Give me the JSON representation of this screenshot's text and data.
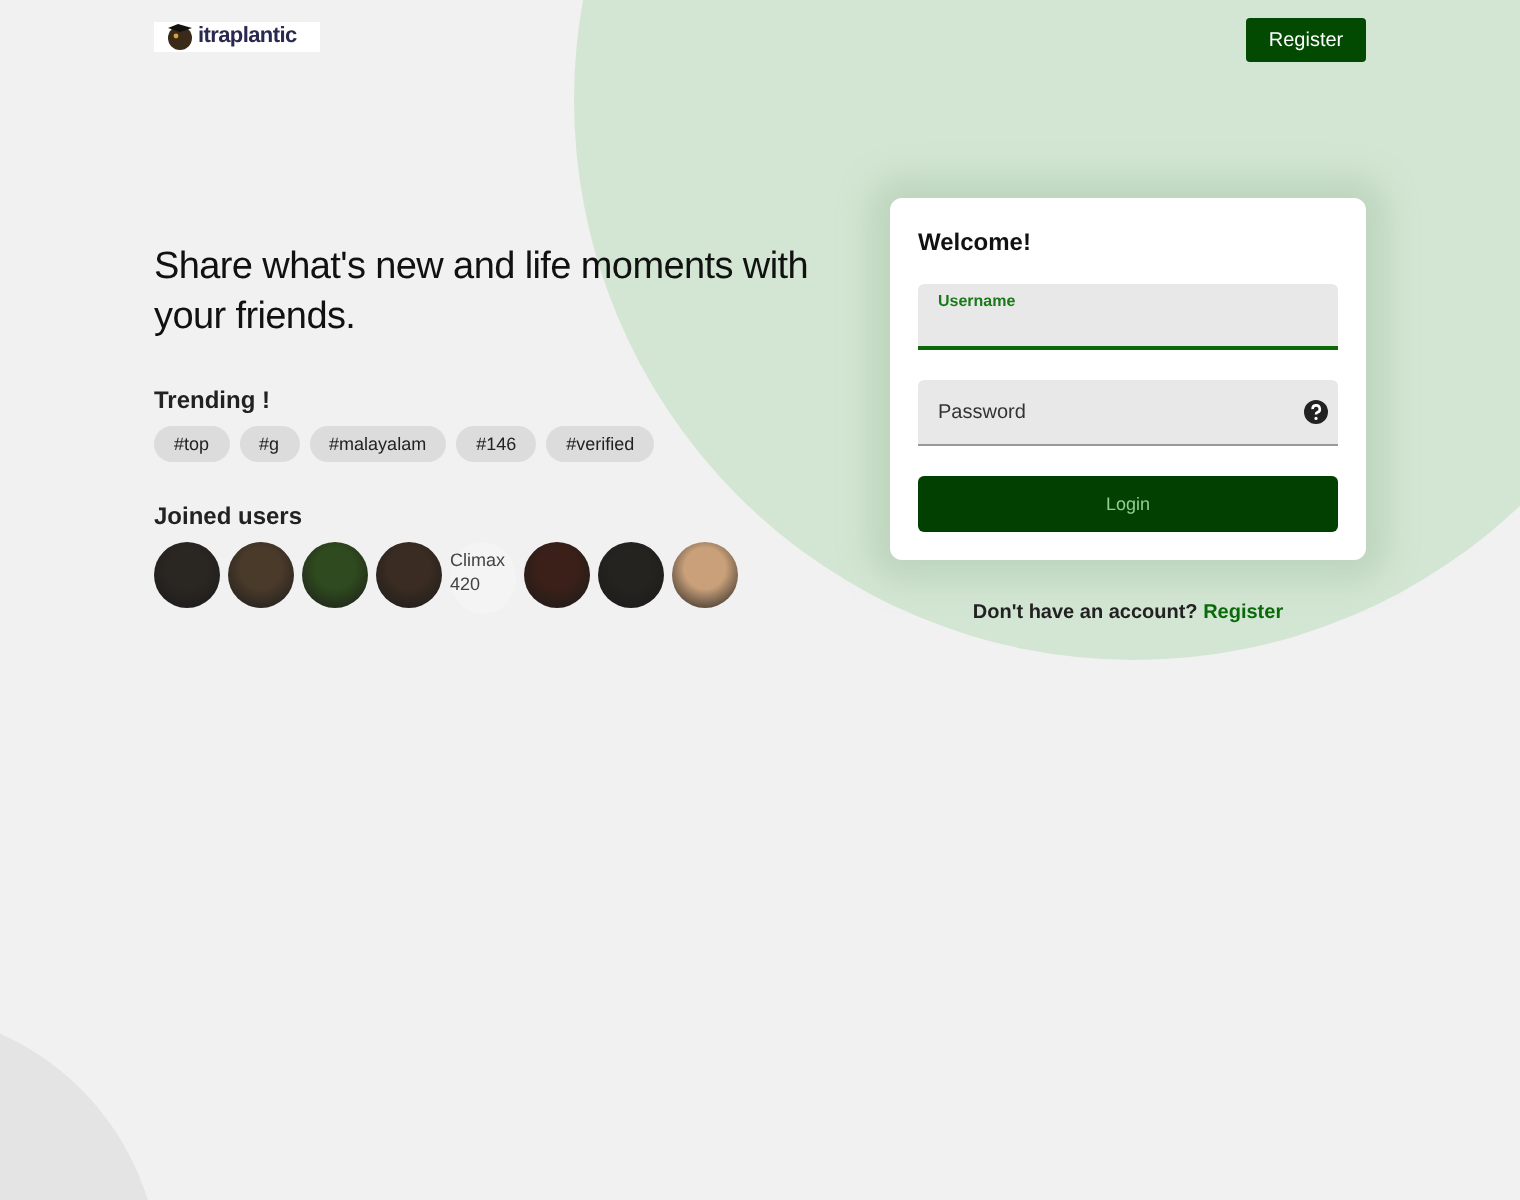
{
  "header": {
    "logo_text": "itraplantic",
    "register_button": "Register"
  },
  "hero": {
    "headline": "Share what's new and life moments with your friends."
  },
  "trending": {
    "title": "Trending !",
    "tags": [
      "#top",
      "#g",
      "#malayalam",
      "#146",
      "#verified"
    ]
  },
  "joined": {
    "title": "Joined users",
    "users": [
      {
        "kind": "photo"
      },
      {
        "kind": "photo"
      },
      {
        "kind": "photo"
      },
      {
        "kind": "photo"
      },
      {
        "kind": "broken",
        "alt": "Climax 420"
      },
      {
        "kind": "photo"
      },
      {
        "kind": "photo"
      },
      {
        "kind": "photo"
      }
    ]
  },
  "login": {
    "title": "Welcome!",
    "username": {
      "label": "Username",
      "focused": true
    },
    "password": {
      "placeholder": "Password"
    },
    "button": "Login"
  },
  "signup": {
    "text": "Don't have an account?",
    "link": "Register"
  }
}
